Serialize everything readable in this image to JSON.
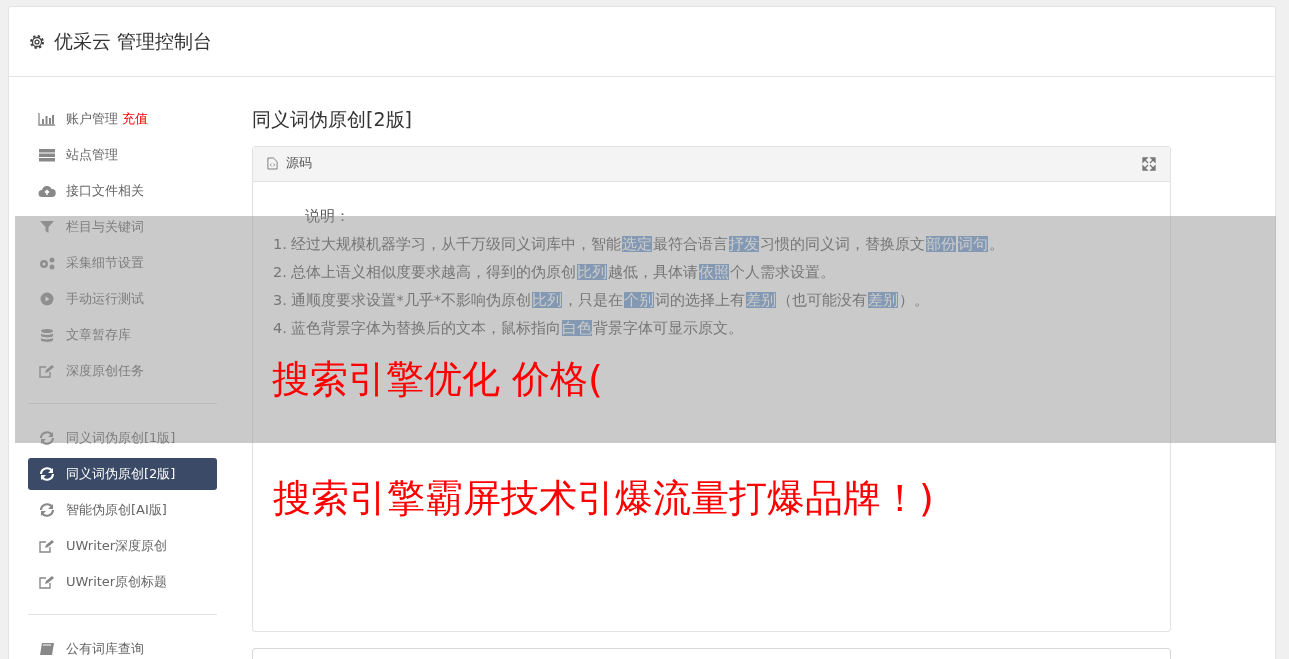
{
  "header": {
    "title": "优采云 管理控制台"
  },
  "sidebar": {
    "groups": [
      {
        "items": [
          {
            "label": "账户管理",
            "badge": "充值",
            "kind": "chart",
            "selected": false
          },
          {
            "label": "站点管理",
            "kind": "server",
            "selected": false
          },
          {
            "label": "接口文件相关",
            "kind": "cloud",
            "selected": false
          },
          {
            "label": "栏目与关键词",
            "kind": "filter",
            "selected": false
          },
          {
            "label": "采集细节设置",
            "kind": "gears",
            "selected": false
          },
          {
            "label": "手动运行测试",
            "kind": "play",
            "selected": false
          },
          {
            "label": "文章暂存库",
            "kind": "database",
            "selected": false
          },
          {
            "label": "深度原创任务",
            "kind": "edit",
            "selected": false
          }
        ]
      },
      {
        "items": [
          {
            "label": "同义词伪原创[1版]",
            "kind": "refresh",
            "selected": false
          },
          {
            "label": "同义词伪原创[2版]",
            "kind": "refresh",
            "selected": true
          },
          {
            "label": "智能伪原创[AI版]",
            "kind": "refresh",
            "selected": false
          },
          {
            "label": "UWriter深度原创",
            "kind": "edit",
            "selected": false
          },
          {
            "label": "UWriter原创标题",
            "kind": "edit",
            "selected": false
          }
        ]
      },
      {
        "items": [
          {
            "label": "公有词库查询",
            "kind": "book",
            "selected": false
          }
        ]
      }
    ]
  },
  "page_title": "同义词伪原创[2版]",
  "editor": {
    "tab": "源码",
    "heading": "说明：",
    "lines": [
      [
        {
          "text": "1. 经过大规模机器学习，从千万级同义词库中，智能",
          "replaced": false
        },
        {
          "text": "选定",
          "replaced": true
        },
        {
          "text": "最符合语言",
          "replaced": false
        },
        {
          "text": "抒发",
          "replaced": true
        },
        {
          "text": "习惯的同义词，替换原文",
          "replaced": false
        },
        {
          "text": "部份",
          "replaced": true
        },
        {
          "text": "词句",
          "replaced": true
        },
        {
          "text": "。",
          "replaced": false
        }
      ],
      [
        {
          "text": "2. 总体上语义相似度要求越高，得到的伪原创",
          "replaced": false
        },
        {
          "text": "比列",
          "replaced": true
        },
        {
          "text": "越低，具体请",
          "replaced": false
        },
        {
          "text": "依照",
          "replaced": true
        },
        {
          "text": "个人需求设置。",
          "replaced": false
        }
      ],
      [
        {
          "text": "3. 通顺度要求设置*几乎*不影响伪原创",
          "replaced": false
        },
        {
          "text": "比列",
          "replaced": true
        },
        {
          "text": "，只是在",
          "replaced": false
        },
        {
          "text": "个别",
          "replaced": true
        },
        {
          "text": "词的选择上有",
          "replaced": false
        },
        {
          "text": "差别",
          "replaced": true
        },
        {
          "text": "（也可能没有",
          "replaced": false
        },
        {
          "text": "差别",
          "replaced": true
        },
        {
          "text": "）。",
          "replaced": false
        }
      ],
      [
        {
          "text": "4. 蓝色背景字体为替换后的文本，鼠标指向",
          "replaced": false
        },
        {
          "text": "白色",
          "replaced": true
        },
        {
          "text": "背景字体可显示原文。",
          "replaced": false
        }
      ]
    ],
    "promo_text": "搜索引擎霸屏技术引爆流量打爆品牌！)"
  },
  "overlay_banner": {
    "text": "搜索引擎优化 价格("
  }
}
